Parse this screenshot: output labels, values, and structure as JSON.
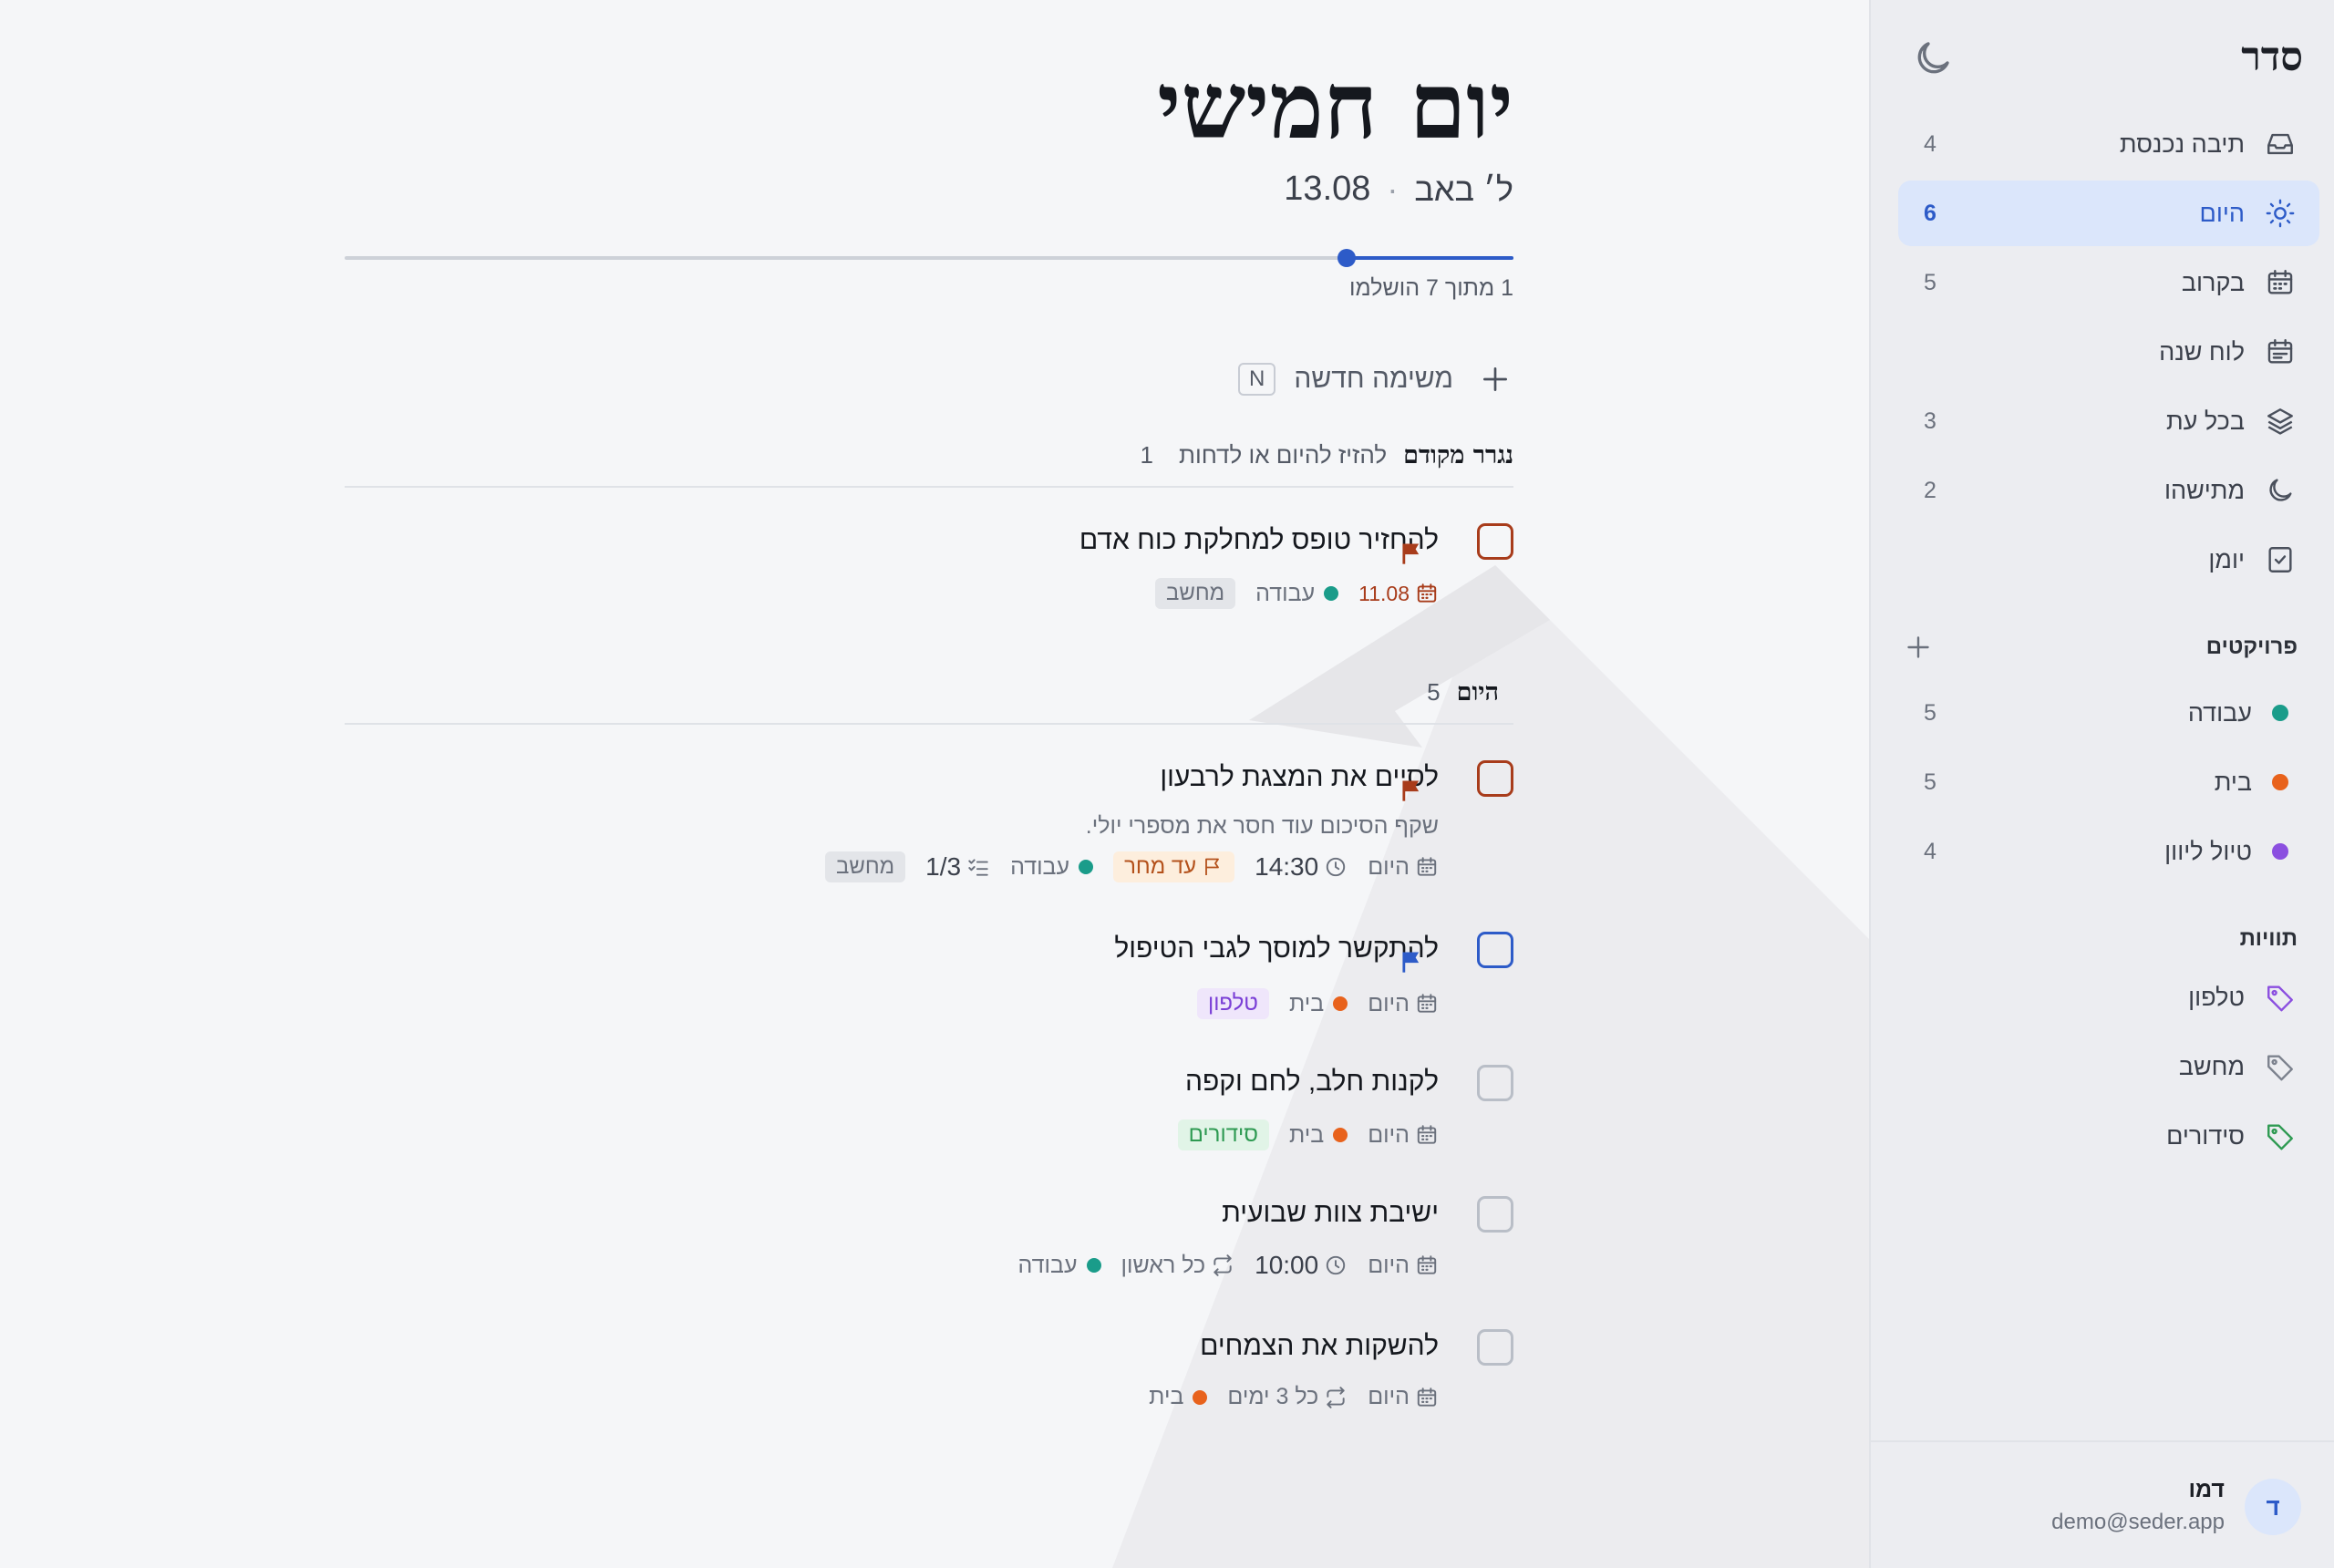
{
  "app": {
    "name": "סדר"
  },
  "nav": [
    {
      "id": "inbox",
      "label": "תיבה נכנסת",
      "count": "4",
      "icon": "inbox-icon"
    },
    {
      "id": "today",
      "label": "היום",
      "count": "6",
      "icon": "sun-icon",
      "active": true
    },
    {
      "id": "upcoming",
      "label": "בקרוב",
      "count": "5",
      "icon": "calendar-icon"
    },
    {
      "id": "calendar",
      "label": "לוח שנה",
      "count": "",
      "icon": "calendar-grid-icon"
    },
    {
      "id": "anytime",
      "label": "בכל עת",
      "count": "3",
      "icon": "layers-icon"
    },
    {
      "id": "someday",
      "label": "מתישהו",
      "count": "2",
      "icon": "moon-icon"
    },
    {
      "id": "logbook",
      "label": "יומן",
      "count": "",
      "icon": "checklist-icon"
    }
  ],
  "projects": {
    "heading": "פרויקטים",
    "items": [
      {
        "label": "עבודה",
        "count": "5",
        "color": "#1a9c8a"
      },
      {
        "label": "בית",
        "count": "5",
        "color": "#e8621c"
      },
      {
        "label": "טיול ליוון",
        "count": "4",
        "color": "#8b4fe0"
      }
    ]
  },
  "labels": {
    "heading": "תוויות",
    "items": [
      {
        "label": "טלפון",
        "color": "#8b4fe0",
        "icon": "tag-icon"
      },
      {
        "label": "מחשב",
        "color": "#7c828e",
        "icon": "tag-icon"
      },
      {
        "label": "סידורים",
        "color": "#2e9a52",
        "icon": "tag-icon"
      }
    ]
  },
  "user": {
    "name": "דמו",
    "email": "demo@seder.app",
    "initial": "ד"
  },
  "header": {
    "title": "יום חמישי",
    "hebrew_date": "ל׳ באב",
    "separator": "·",
    "date": "13.08",
    "progress_text": "1 מתוך 7 הושלמו",
    "progress": 0.143
  },
  "new_task": {
    "label": "משימה חדשה",
    "shortcut": "N"
  },
  "groups": {
    "overdue": {
      "title": "נגרר מקודם",
      "hint": "להזיז להיום או לדחות",
      "count": "1"
    },
    "today": {
      "title": "היום",
      "count": "5"
    }
  },
  "tasks": [
    {
      "title": "להחזיר טופס למחלקת כוח אדם",
      "date": "11.08",
      "project": "עבודה",
      "tag": "מחשב",
      "priority": "high"
    },
    {
      "title": "לסיים את המצגת לרבעון",
      "note": "שקף הסיכום עוד חסר את מספרי יולי.",
      "date": "היום",
      "time": "14:30",
      "deadline": "עד מחר",
      "project": "עבודה",
      "checklist": "1/3",
      "tag": "מחשב",
      "priority": "high"
    },
    {
      "title": "להתקשר למוסך לגבי הטיפול",
      "date": "היום",
      "project": "בית",
      "tag": "טלפון",
      "priority": "medium"
    },
    {
      "title": "לקנות חלב, לחם וקפה",
      "date": "היום",
      "project": "בית",
      "tag": "סידורים"
    },
    {
      "title": "ישיבת צוות שבועית",
      "date": "היום",
      "time": "10:00",
      "repeat": "כל ראשון",
      "project": "עבודה"
    },
    {
      "title": "להשקות את הצמחים",
      "date": "היום",
      "repeat": "כל 3 ימים",
      "project": "בית"
    }
  ],
  "colors": {
    "accent": "#2d5bc8",
    "overdue": "#a83c1b",
    "priority_high": "#a83c1b",
    "priority_medium": "#2d5bc8",
    "work": "#1a9c8a",
    "home": "#e8621c",
    "greece": "#8b4fe0"
  }
}
